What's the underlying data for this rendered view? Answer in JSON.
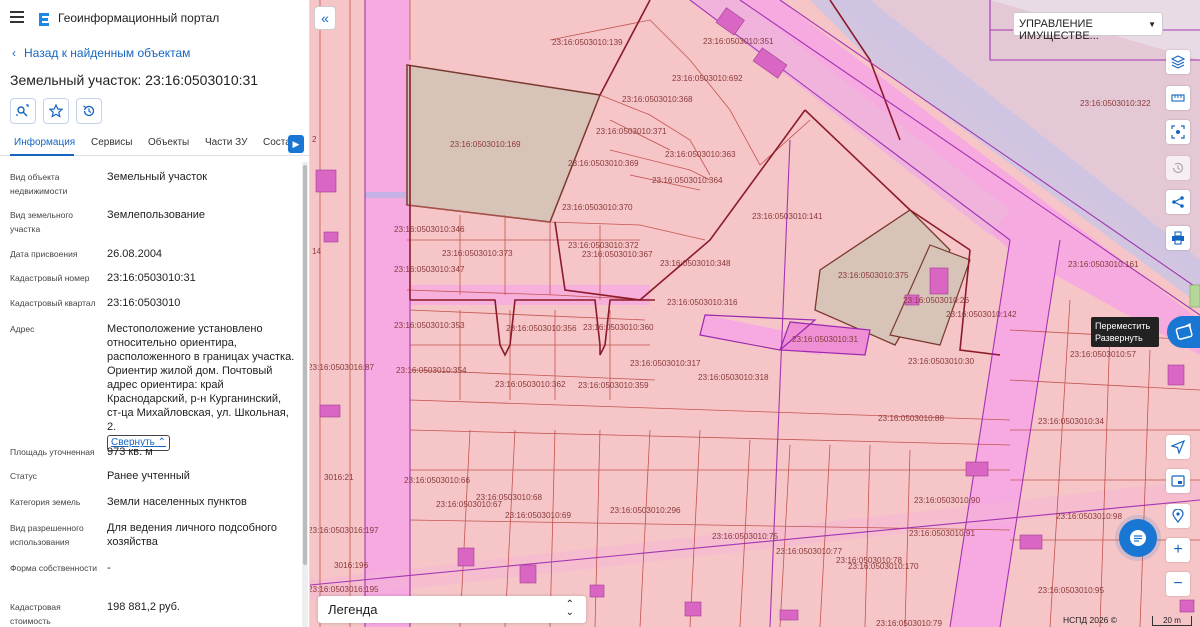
{
  "header": {
    "app_title": "Геоинформационный портал",
    "back_label": "Назад к найденным объектам",
    "title": "Земельный участок: 23:16:0503010:31"
  },
  "tabs": [
    {
      "label": "Информация",
      "active": true
    },
    {
      "label": "Сервисы"
    },
    {
      "label": "Объекты"
    },
    {
      "label": "Части ЗУ"
    },
    {
      "label": "Соста"
    }
  ],
  "properties": [
    {
      "label": "Вид объекта недвижимости",
      "value": "Земельный участок"
    },
    {
      "label": "Вид земельного участка",
      "value": "Землепользование"
    },
    {
      "label": "Дата присвоения",
      "value": "26.08.2004"
    },
    {
      "label": "Кадастровый номер",
      "value": "23:16:0503010:31"
    },
    {
      "label": "Кадастровый квартал",
      "value": "23:16:0503010"
    },
    {
      "label": "Адрес",
      "value": "Местоположение установлено относительно ориентира, расположенного в границах участка. Ориентир жилой дом. Почтовый адрес ориентира: край Краснодарский, р-н Курганинский, ст-ца Михайловская, ул. Школьная, 2."
    },
    {
      "label": "Площадь уточненная",
      "value": "973 кв. м"
    },
    {
      "label": "Статус",
      "value": "Ранее учтенный"
    },
    {
      "label": "Категория земель",
      "value": "Земли населенных пунктов"
    },
    {
      "label": "Вид разрешенного использования",
      "value": "Для ведения личного подсобного хозяйства"
    },
    {
      "label": "Форма собственности",
      "value": "-"
    },
    {
      "label": "Кадастровая стоимость",
      "value": "198 881,2 руб."
    }
  ],
  "collapse_label": "Свернуть",
  "map": {
    "layer_select": "УПРАВЛЕНИЕ ИМУЩЕСТВЕ...",
    "tooltip_line1": "Переместить",
    "tooltip_line2": "Развернуть",
    "legend_label": "Легенда",
    "copyright": "НСПД 2026 ©",
    "scale": "20 m",
    "parcel_labels": [
      "23:16:0503010:139",
      "23:16:0503010:351",
      "23:16:0503010:692",
      "23:16:0503010:368",
      "23:16:0503010:322",
      "23:16:0503010:371",
      "23:16:0503010:169",
      "23:16:0503010:363",
      "23:16:0503010:369",
      "23:16:0503010:364",
      "23:16:0503010:370",
      "23:16:0503010:141",
      "23:16:0503010:346",
      "23:16:0503010:372",
      "23:16:0503010:373",
      "23:16:0503010:367",
      "23:16:0503010:348",
      "23:16:0503010:161",
      "23:16:0503010:347",
      "23:16:0503010:375",
      "23:16:0503010:26",
      "23:16:0503010:316",
      "23:16:0503010:142",
      "23:16:0503010:353",
      "23:16:0503010:356",
      "23:16:0503010:360",
      "23:16:0503010:31",
      "23:16:0503010:57",
      "23:16:0503010:30",
      "23:16:0503010:317",
      "23:16:0503010:354",
      "23:16:0503010:318",
      "23:16:0503010:362",
      "23:16:0503010:359",
      "23:16:0503010:88",
      "23:16:0503010:34",
      "23:16:0503010:66",
      "23:16:0503010:68",
      "23:16:0503010:67",
      "23:16:0503010:296",
      "23:16:0503010:69",
      "23:16:0503010:90",
      "23:16:0503010:98",
      "23:16:0503010:75",
      "23:16:0503010:91",
      "23:16:0503010:77",
      "23:16:0503010:78",
      "23:16:0503010:170",
      "23:16:0503010:95",
      "23:16:0503010:79",
      "23:16:0503016:87",
      "3016:21",
      "23:16:0503016:197",
      "3016:196",
      "23:16:0503016:195",
      "14",
      "2"
    ]
  }
}
